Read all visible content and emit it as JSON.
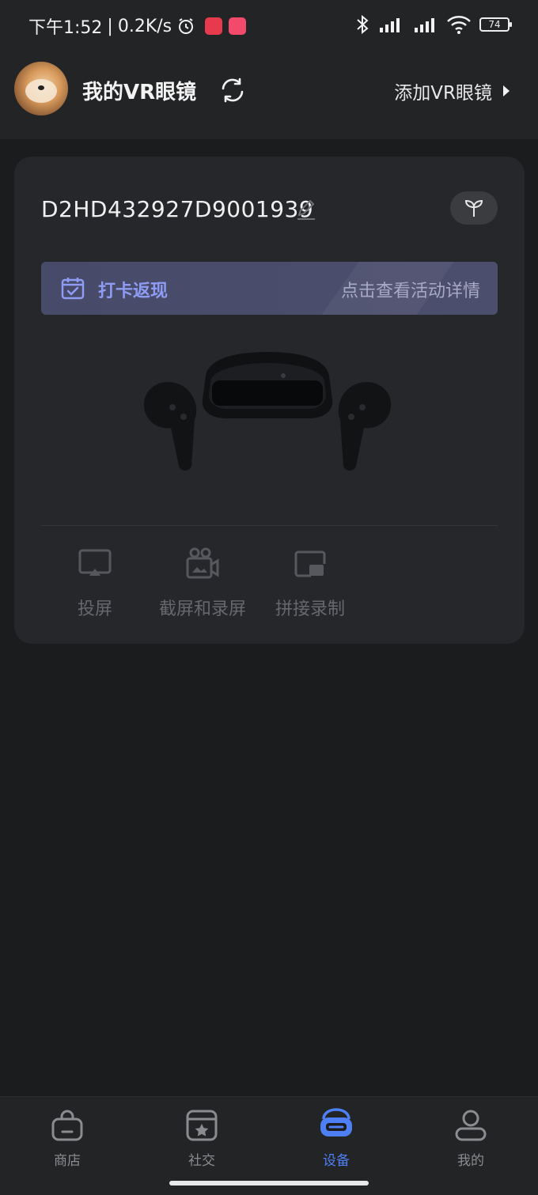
{
  "status_bar": {
    "time": "下午1:52",
    "speed": "0.2K/s",
    "battery": "74"
  },
  "header": {
    "title": "我的VR眼镜",
    "add_label": "添加VR眼镜"
  },
  "device": {
    "name": "D2HD432927D9001939"
  },
  "banner": {
    "title": "打卡返现",
    "link_text": "点击查看活动详情"
  },
  "functions": [
    {
      "label": "投屏",
      "icon": "cast-icon"
    },
    {
      "label": "截屏和录屏",
      "icon": "screenshot-record-icon"
    },
    {
      "label": "拼接录制",
      "icon": "splice-record-icon"
    }
  ],
  "tabs": [
    {
      "label": "商店",
      "icon": "shop-icon"
    },
    {
      "label": "社交",
      "icon": "social-icon"
    },
    {
      "label": "设备",
      "icon": "vr-device-icon",
      "active": true
    },
    {
      "label": "我的",
      "icon": "profile-icon"
    }
  ],
  "colors": {
    "accent": "#4f7ff5",
    "banner_text": "#8f9cf3",
    "background": "#1b1c1e",
    "card": "#26272a"
  }
}
